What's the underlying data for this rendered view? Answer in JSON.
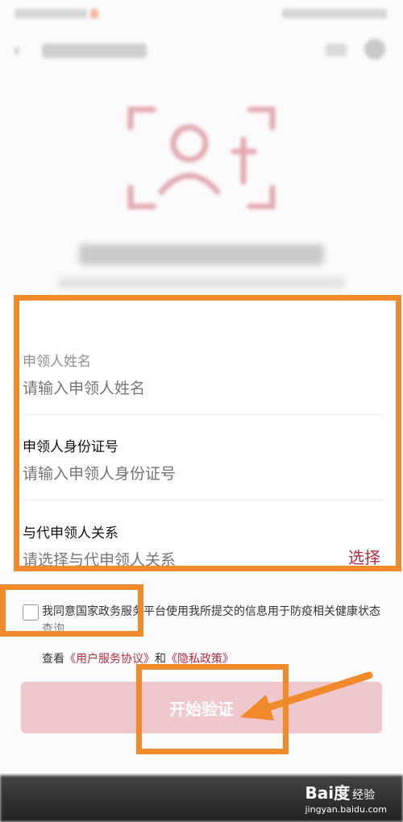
{
  "form": {
    "name": {
      "label": "申领人姓名",
      "placeholder": "请输入申领人姓名"
    },
    "id_number": {
      "label": "申领人身份证号",
      "placeholder": "请输入申领人身份证号"
    },
    "relation": {
      "label": "与代申领人关系",
      "placeholder": "请选择与代申领人关系",
      "select_label": "选择"
    }
  },
  "agreement": {
    "text": "我同意国家政务服务平台使用我所提交的信息用于防疫相关健康状态查询",
    "prefix": "查看",
    "link1": "《用户服务协议》",
    "conjunction": "和",
    "link2": "《隐私政策》"
  },
  "start_button": "开始验证",
  "watermark": {
    "brand": "Bai度",
    "brand_suffix": "经验",
    "url": "jingyan.baidu.com"
  },
  "colors": {
    "accent": "#b52b3f",
    "button_bg": "#f0c7cd",
    "annotation": "#f08a2a"
  }
}
